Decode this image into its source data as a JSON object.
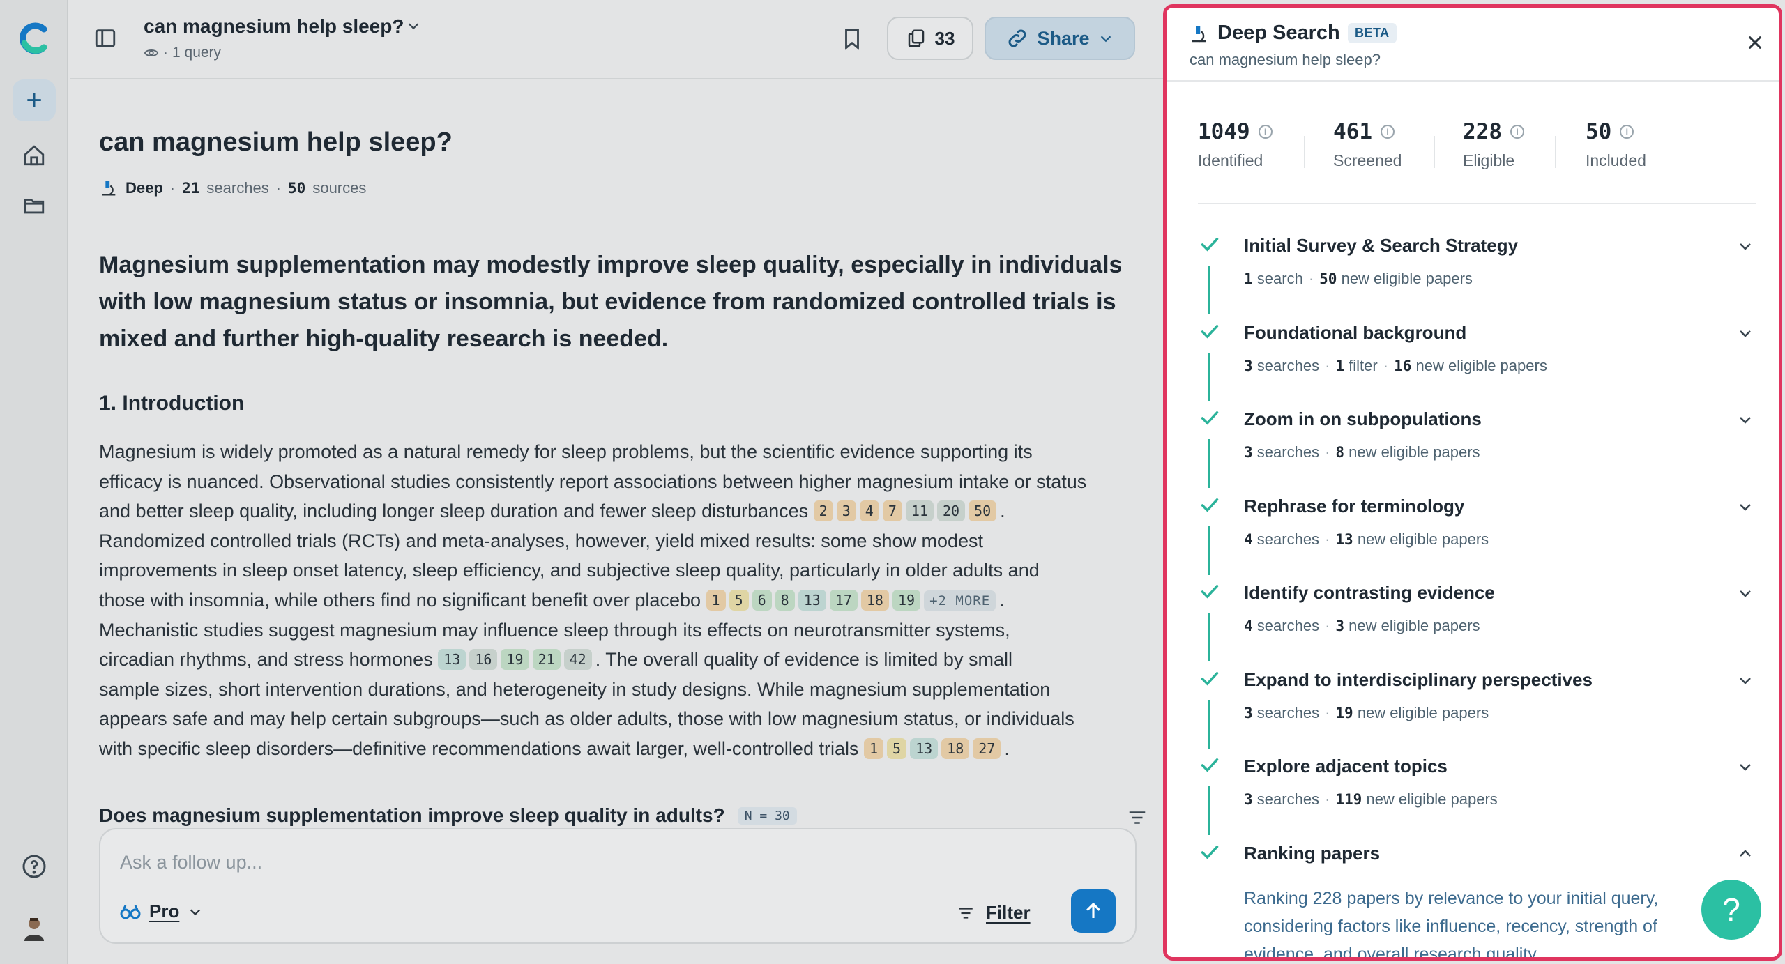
{
  "header": {
    "title": "can magnesium help sleep?",
    "query_count": "1 query",
    "sources_count": "33",
    "share_label": "Share"
  },
  "article": {
    "title": "can magnesium help sleep?",
    "mode": "Deep",
    "searches_num": "21",
    "searches_label": "searches",
    "sources_num": "50",
    "sources_label": "sources",
    "summary": "Magnesium supplementation may modestly improve sleep quality, especially in individuals with low magnesium status or insomnia, but evidence from randomized controlled trials is mixed and further high-quality research is needed.",
    "section_title": "1. Introduction",
    "para": [
      "Magnesium is widely promoted as a natural remedy for sleep problems, but the scientific evidence supporting its",
      "efficacy is nuanced. Observational studies consistently report associations between higher magnesium intake or status",
      "and better sleep quality, including longer sleep duration and fewer sleep disturbances",
      "Randomized controlled trials (RCTs) and meta-analyses, however, yield mixed results: some show modest",
      "improvements in sleep onset latency, sleep efficiency, and subjective sleep quality, particularly in older adults and",
      "those with insomnia, while others find no significant benefit over placebo",
      "Mechanistic studies suggest magnesium may influence sleep through its effects on neurotransmitter systems,",
      "circadian rhythms, and stress hormones",
      ". The overall quality of evidence is limited by small",
      "sample sizes, short intervention durations, and heterogeneity in study designs. While magnesium supplementation",
      "appears safe and may help certain subgroups—such as older adults, those with low magnesium status, or individuals",
      "with specific sleep disorders—definitive recommendations await larger, well-controlled trials"
    ],
    "period": ".",
    "cites_a": [
      "2",
      "3",
      "4",
      "7",
      "11",
      "20",
      "50"
    ],
    "cites_b": [
      "1",
      "5",
      "6",
      "8",
      "13",
      "17",
      "18",
      "19"
    ],
    "cites_b_more": "+2 MORE",
    "cites_c": [
      "13",
      "16",
      "19",
      "21",
      "42"
    ],
    "cites_d": [
      "1",
      "5",
      "13",
      "18",
      "27"
    ],
    "question": "Does magnesium supplementation improve sleep quality in adults?",
    "question_n": "N = 30"
  },
  "composer": {
    "placeholder": "Ask a follow up...",
    "mode_label": "Pro",
    "filter_label": "Filter"
  },
  "panel": {
    "title": "Deep Search",
    "badge": "BETA",
    "subtitle": "can magnesium help sleep?",
    "stats": [
      {
        "value": "1049",
        "label": "Identified"
      },
      {
        "value": "461",
        "label": "Screened"
      },
      {
        "value": "228",
        "label": "Eligible"
      },
      {
        "value": "50",
        "label": "Included"
      }
    ],
    "steps": [
      {
        "title": "Initial Survey & Search Strategy",
        "parts": [
          [
            "1",
            "search"
          ],
          [
            "50",
            "new eligible papers"
          ]
        ]
      },
      {
        "title": "Foundational background",
        "parts": [
          [
            "3",
            "searches"
          ],
          [
            "1",
            "filter"
          ],
          [
            "16",
            "new eligible papers"
          ]
        ]
      },
      {
        "title": "Zoom in on subpopulations",
        "parts": [
          [
            "3",
            "searches"
          ],
          [
            "8",
            "new eligible papers"
          ]
        ]
      },
      {
        "title": "Rephrase for terminology",
        "parts": [
          [
            "4",
            "searches"
          ],
          [
            "13",
            "new eligible papers"
          ]
        ]
      },
      {
        "title": "Identify contrasting evidence",
        "parts": [
          [
            "4",
            "searches"
          ],
          [
            "3",
            "new eligible papers"
          ]
        ]
      },
      {
        "title": "Expand to interdisciplinary perspectives",
        "parts": [
          [
            "3",
            "searches"
          ],
          [
            "19",
            "new eligible papers"
          ]
        ]
      },
      {
        "title": "Explore adjacent topics",
        "parts": [
          [
            "3",
            "searches"
          ],
          [
            "119",
            "new eligible papers"
          ]
        ]
      },
      {
        "title": "Ranking papers",
        "parts": []
      }
    ],
    "ranking_text": "Ranking 228 papers by relevance to your initial query, considering factors like influence, recency, strength of evidence, and overall research quality."
  },
  "help_label": "?",
  "colors": {
    "accent": "#1577c4",
    "check": "#2bb39a",
    "highlight_border": "#e0355f"
  }
}
